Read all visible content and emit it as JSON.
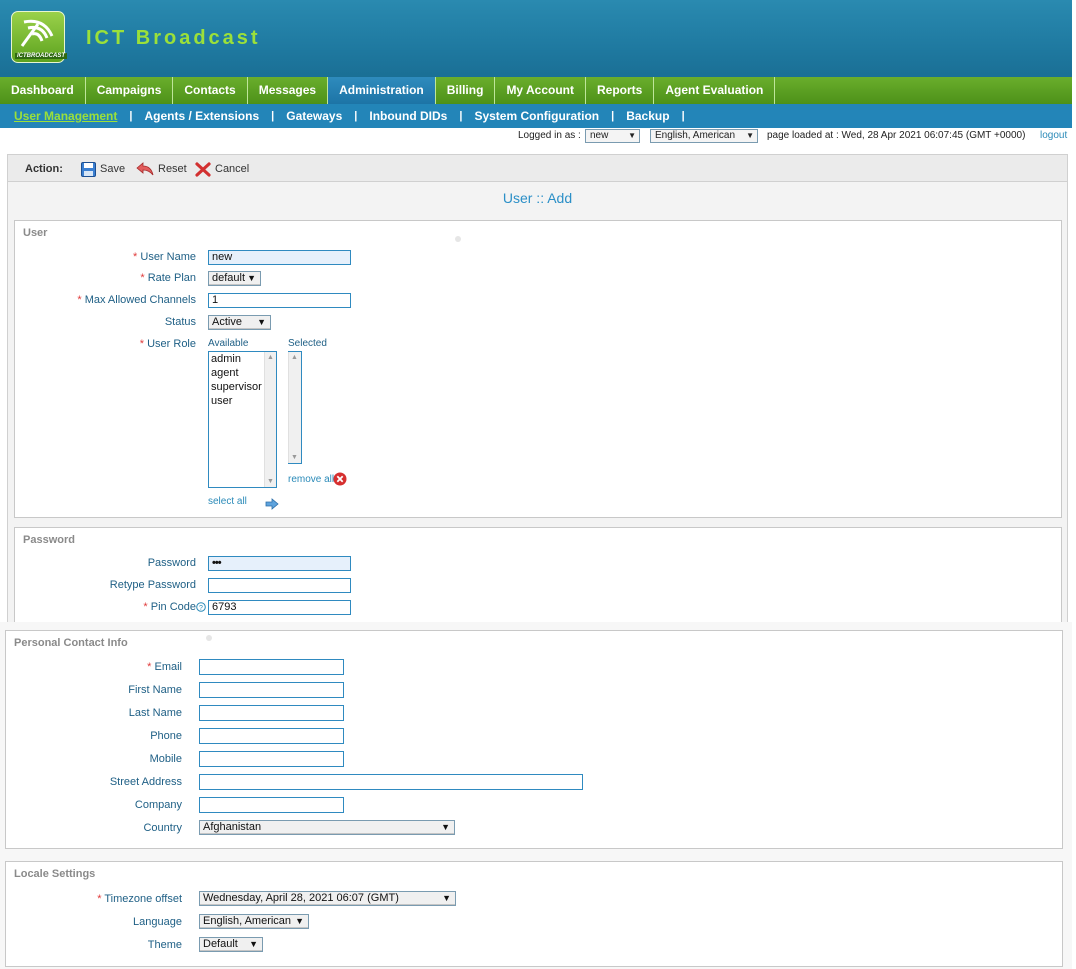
{
  "app": {
    "brand": "ICT Broadcast",
    "logo_text": "ICTBROADCAST"
  },
  "main_nav": [
    {
      "label": "Dashboard",
      "active": false
    },
    {
      "label": "Campaigns",
      "active": false
    },
    {
      "label": "Contacts",
      "active": false
    },
    {
      "label": "Messages",
      "active": false
    },
    {
      "label": "Administration",
      "active": true
    },
    {
      "label": "Billing",
      "active": false
    },
    {
      "label": "My Account",
      "active": false
    },
    {
      "label": "Reports",
      "active": false
    },
    {
      "label": "Agent Evaluation",
      "active": false
    }
  ],
  "sub_nav": [
    {
      "label": "User Management",
      "active": true
    },
    {
      "label": "Agents / Extensions",
      "active": false
    },
    {
      "label": "Gateways",
      "active": false
    },
    {
      "label": "Inbound DIDs",
      "active": false
    },
    {
      "label": "System Configuration",
      "active": false
    },
    {
      "label": "Backup",
      "active": false
    }
  ],
  "status": {
    "logged_in_label": "Logged in as :",
    "logged_in_user": "new",
    "language": "English, American",
    "page_loaded": "page loaded at : Wed, 28 Apr 2021 06:07:45 (GMT +0000)",
    "logout": "logout"
  },
  "actions": {
    "label": "Action:",
    "save": "Save",
    "reset": "Reset",
    "cancel": "Cancel"
  },
  "form_title": "User :: Add",
  "user_section": {
    "title": "User",
    "user_name_label": "User Name",
    "user_name_value": "new",
    "rate_plan_label": "Rate Plan",
    "rate_plan_value": "default",
    "max_channels_label": "Max Allowed Channels",
    "max_channels_value": "1",
    "status_label": "Status",
    "status_value": "Active",
    "user_role_label": "User Role",
    "available_label": "Available",
    "selected_label": "Selected",
    "available_roles": [
      "admin",
      "agent",
      "supervisor",
      "user"
    ],
    "select_all": "select all",
    "remove_all": "remove all"
  },
  "password_section": {
    "title": "Password",
    "password_label": "Password",
    "password_value": "•••",
    "retype_label": "Retype Password",
    "retype_value": "",
    "pin_label": "Pin Code",
    "pin_value": "6793"
  },
  "contact_section": {
    "title": "Personal Contact Info",
    "email_label": "Email",
    "first_name_label": "First Name",
    "last_name_label": "Last Name",
    "phone_label": "Phone",
    "mobile_label": "Mobile",
    "street_label": "Street Address",
    "company_label": "Company",
    "country_label": "Country",
    "country_value": "Afghanistan"
  },
  "locale_section": {
    "title": "Locale Settings",
    "timezone_label": "Timezone offset",
    "timezone_value": "Wednesday, April 28, 2021 06:07 (GMT)",
    "language_label": "Language",
    "language_value": "English, American",
    "theme_label": "Theme",
    "theme_value": "Default"
  },
  "colors": {
    "header_blue": "#1f7aa1",
    "nav_green": "#5da31f",
    "subnav_blue": "#2385b8",
    "brand_green": "#9be03a",
    "required_red": "#e03b3b",
    "label_blue": "#1e5f85"
  }
}
